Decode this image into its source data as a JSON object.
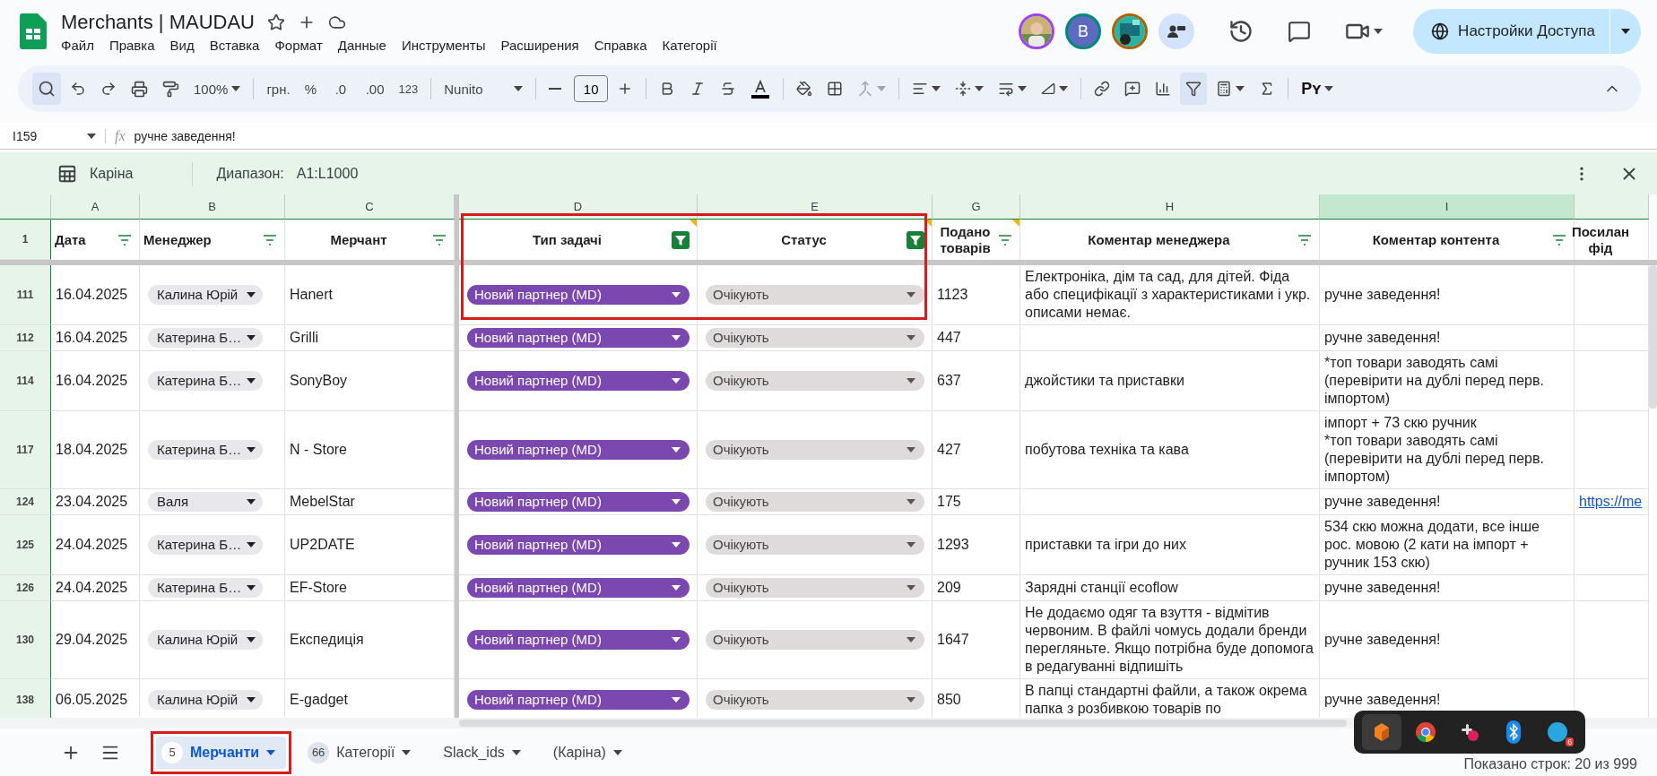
{
  "document": {
    "title": "Merchants | MAUDAU",
    "menu": [
      "Файл",
      "Правка",
      "Вид",
      "Вставка",
      "Формат",
      "Данные",
      "Инструменты",
      "Расширения",
      "Справка",
      "Категорії"
    ]
  },
  "avatars": [
    {
      "kind": "picture"
    },
    {
      "kind": "letter",
      "text": "B"
    },
    {
      "kind": "picture"
    }
  ],
  "share_button": "Настройки Доступа",
  "toolbar": {
    "zoom": "100%",
    "currency": "грн.",
    "percent": "%",
    "decrease_decimals": ".0",
    "increase_decimals": ".00",
    "number_format": "123",
    "font": "Nunito",
    "font_size": "10",
    "addon": "Pʏ",
    "filter_on": true
  },
  "formula_bar": {
    "cell": "I159",
    "fx": "fx",
    "value": "ручне заведення!"
  },
  "filter_view": {
    "name": "Каріна",
    "range_label": "Диапазон:",
    "range": "A1:L1000"
  },
  "columns": [
    {
      "letter": "A",
      "selected": false
    },
    {
      "letter": "B",
      "selected": false
    },
    {
      "letter": "C",
      "selected": false
    },
    {
      "letter": "D",
      "selected": false
    },
    {
      "letter": "E",
      "selected": false
    },
    {
      "letter": "G",
      "selected": false
    },
    {
      "letter": "H",
      "selected": false
    },
    {
      "letter": "I",
      "selected": true
    }
  ],
  "header_row": {
    "number": "1",
    "cells": [
      {
        "text": "Дата",
        "filtered": false,
        "note": false
      },
      {
        "text": "Менеджер",
        "filtered": false,
        "note": false
      },
      {
        "text": "Мерчант",
        "filtered": false,
        "note": false
      },
      {
        "text": "Тип задачі",
        "filtered": true,
        "note": true
      },
      {
        "text": "Статус",
        "filtered": true,
        "note": true
      },
      {
        "text": "Подано товарів",
        "filtered": false,
        "note": true
      },
      {
        "text": "Коментар менеджера",
        "filtered": false,
        "note": false
      },
      {
        "text": "Коментар контента",
        "filtered": false,
        "note": false
      },
      {
        "text": "Посилан\nфід"
      }
    ]
  },
  "rows": [
    {
      "number": "111",
      "date": "16.04.2025",
      "manager": "Калина Юрій",
      "merchant": "Hanert",
      "task": "Новий партнер (MD)",
      "status": "Очікують",
      "count": "1123",
      "manager_comment": "Електроніка, дім та сад, для дітей. Фіда або специфікації з характеристиками і укр. описами немає.",
      "content_comment": "ручне заведення!"
    },
    {
      "number": "112",
      "date": "16.04.2025",
      "manager": "Катерина Б…",
      "merchant": "Grilli",
      "task": "Новий партнер (MD)",
      "status": "Очікують",
      "count": "447",
      "content_comment": "ручне заведення!"
    },
    {
      "number": "114",
      "date": "16.04.2025",
      "manager": "Катерина Б…",
      "merchant": "SonyBoy",
      "task": "Новий партнер (MD)",
      "status": "Очікують",
      "count": "637",
      "manager_comment": " джойстики та приставки",
      "content_comment": "*топ товари заводять самі (перевірити на дублі перед перв. імпортом)"
    },
    {
      "number": "117",
      "date": "18.04.2025",
      "manager": "Катерина Б…",
      "merchant": "N - Store",
      "task": "Новий партнер (MD)",
      "status": "Очікують",
      "count": "427",
      "manager_comment": "побутова техніка та кава",
      "content_comment": "імпорт + 73 скю ручник\n*топ товари заводять самі (перевірити на дублі перед перв. імпортом)"
    },
    {
      "number": "124",
      "date": "23.04.2025",
      "manager": "Валя",
      "merchant": "MebelStar",
      "task": "Новий партнер (MD)",
      "status": "Очікують",
      "count": "175",
      "content_comment": "ручне заведення!",
      "link": "https://me"
    },
    {
      "number": "125",
      "date": "24.04.2025",
      "manager": "Катерина Б…",
      "merchant": "UP2DATE",
      "task": "Новий партнер (MD)",
      "status": "Очікують",
      "count": "1293",
      "manager_comment": "приставки та ігри до них",
      "content_comment": "534 скю можна додати, все інше рос. мовою (2 кати на імпорт + ручник 153 скю)"
    },
    {
      "number": "126",
      "date": "24.04.2025",
      "manager": "Катерина Б…",
      "merchant": "EF-Store",
      "task": "Новий партнер (MD)",
      "status": "Очікують",
      "count": "209",
      "manager_comment": "Зарядні станції ecoflow",
      "content_comment": "ручне заведення!"
    },
    {
      "number": "130",
      "date": "29.04.2025",
      "manager": "Калина Юрій",
      "merchant": "Експедиція",
      "task": "Новий партнер (MD)",
      "status": "Очікують",
      "count": "1647",
      "manager_comment": "Не додаємо одяг та взуття - відмітив червоним. В файлі чомусь додали бренди перегляньте. Якщо потрібна буде допомога в редагуванні відпишіть",
      "content_comment": "ручне заведення!"
    },
    {
      "number": "138",
      "date": "06.05.2025",
      "manager": "Калина Юрій",
      "merchant": "E-gadget",
      "task": "Новий партнер (MD)",
      "status": "Очікують",
      "count": "850",
      "manager_comment": "В папці стандартні файли, а також окрема папка з розбивкою товарів по",
      "content_comment": "ручне заведення!"
    }
  ],
  "sheet_tabs": [
    {
      "count": "5",
      "label": "Мерчанти",
      "selected": true,
      "highlighted": true
    },
    {
      "count": "66",
      "label": "Категорії",
      "selected": false,
      "highlighted": false
    },
    {
      "label": "Slack_ids",
      "selected": false,
      "highlighted": false
    },
    {
      "label": "(Каріна)",
      "selected": false,
      "highlighted": false
    }
  ],
  "status": "Показано строк: 20 из 999",
  "dock": [
    {
      "kind": "shapes"
    },
    {
      "kind": "browser"
    },
    {
      "kind": "chat"
    },
    {
      "kind": "bluetooth"
    },
    {
      "kind": "mail",
      "badge": "6"
    }
  ]
}
